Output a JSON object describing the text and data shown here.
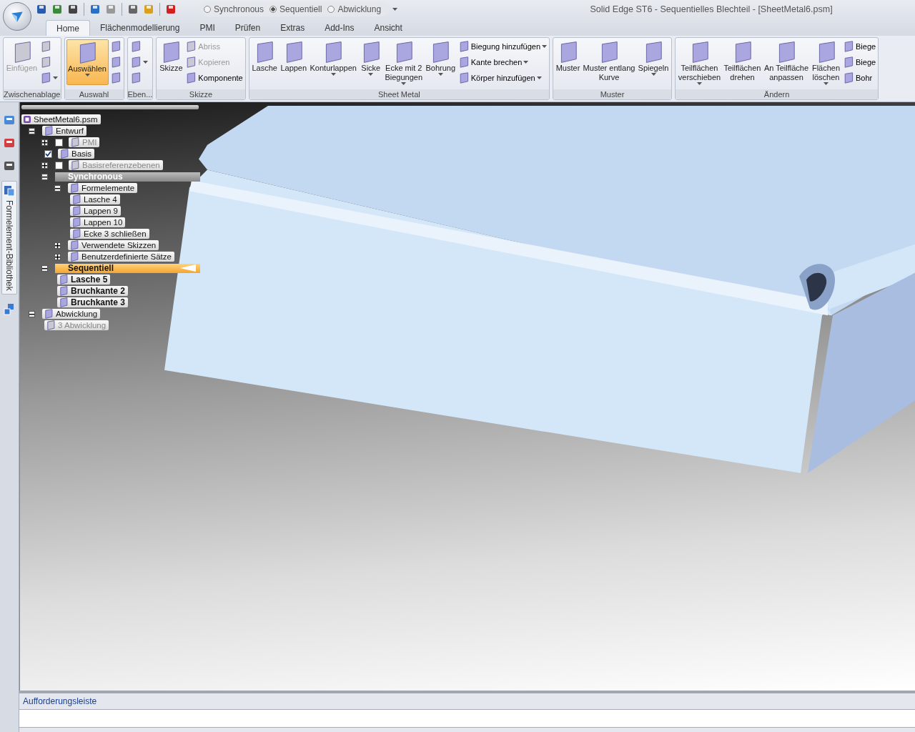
{
  "window": {
    "title": "Solid Edge ST6 - Sequentielles Blechteil - [SheetMetal6.psm]"
  },
  "modes": [
    {
      "label": "Synchronous",
      "selected": false
    },
    {
      "label": "Sequentiell",
      "selected": true
    },
    {
      "label": "Abwicklung",
      "selected": false
    }
  ],
  "tabs": [
    {
      "label": "Home",
      "selected": true
    },
    {
      "label": "Flächenmodellierung",
      "selected": false
    },
    {
      "label": "PMI",
      "selected": false
    },
    {
      "label": "Prüfen",
      "selected": false
    },
    {
      "label": "Extras",
      "selected": false
    },
    {
      "label": "Add-Ins",
      "selected": false
    },
    {
      "label": "Ansicht",
      "selected": false
    }
  ],
  "ribbon": [
    {
      "title": "Zwischenablage",
      "items": [
        {
          "kind": "large",
          "label": "Einfügen",
          "disabled": true,
          "selected": false,
          "dropdown": false
        },
        {
          "kind": "icon",
          "disabled": true,
          "dropdown": false
        },
        {
          "kind": "icon",
          "disabled": true,
          "dropdown": false
        },
        {
          "kind": "icon",
          "disabled": false,
          "dropdown": true
        }
      ]
    },
    {
      "title": "Auswahl",
      "items": [
        {
          "kind": "large",
          "label": "Auswählen",
          "disabled": false,
          "selected": true,
          "dropdown": true
        },
        {
          "kind": "icon",
          "disabled": false,
          "dropdown": false
        },
        {
          "kind": "icon",
          "disabled": false,
          "dropdown": false
        },
        {
          "kind": "icon",
          "disabled": false,
          "dropdown": false
        }
      ]
    },
    {
      "title": "Eben...",
      "items": [
        {
          "kind": "icon",
          "disabled": false,
          "dropdown": false
        },
        {
          "kind": "icon",
          "disabled": false,
          "dropdown": true
        },
        {
          "kind": "icon",
          "disabled": false,
          "dropdown": false
        }
      ]
    },
    {
      "title": "Skizze",
      "items": [
        {
          "kind": "large",
          "label": "Skizze",
          "disabled": false,
          "selected": false,
          "dropdown": false
        },
        {
          "kind": "small",
          "label": "Abriss",
          "disabled": true,
          "dropdown": false
        },
        {
          "kind": "small",
          "label": "Kopieren",
          "disabled": true,
          "dropdown": false
        },
        {
          "kind": "small",
          "label": "Komponente",
          "disabled": false,
          "dropdown": false
        }
      ]
    },
    {
      "title": "Sheet Metal",
      "items": [
        {
          "kind": "large",
          "label": "Lasche",
          "disabled": false,
          "selected": false,
          "dropdown": false
        },
        {
          "kind": "large",
          "label": "Lappen",
          "disabled": false,
          "selected": false,
          "dropdown": false
        },
        {
          "kind": "large",
          "label": "Konturlappen",
          "disabled": false,
          "selected": false,
          "dropdown": true
        },
        {
          "kind": "large",
          "label": "Sicke",
          "disabled": false,
          "selected": false,
          "dropdown": true
        },
        {
          "kind": "large",
          "label": "Ecke mit 2 Biegungen",
          "disabled": false,
          "selected": false,
          "dropdown": true
        },
        {
          "kind": "large",
          "label": "Bohrung",
          "disabled": false,
          "selected": false,
          "dropdown": true
        },
        {
          "kind": "small",
          "label": "Biegung hinzufügen",
          "disabled": false,
          "dropdown": true
        },
        {
          "kind": "small",
          "label": "Kante brechen",
          "disabled": false,
          "dropdown": true
        },
        {
          "kind": "small",
          "label": "Körper hinzufügen",
          "disabled": false,
          "dropdown": true
        }
      ]
    },
    {
      "title": "Muster",
      "items": [
        {
          "kind": "large",
          "label": "Muster",
          "disabled": false,
          "selected": false,
          "dropdown": false
        },
        {
          "kind": "large",
          "label": "Muster entlang Kurve",
          "disabled": false,
          "selected": false,
          "dropdown": false
        },
        {
          "kind": "large",
          "label": "Spiegeln",
          "disabled": false,
          "selected": false,
          "dropdown": true
        }
      ]
    },
    {
      "title": "Ändern",
      "items": [
        {
          "kind": "large",
          "label": "Teilflächen verschieben",
          "disabled": false,
          "selected": false,
          "dropdown": true
        },
        {
          "kind": "large",
          "label": "Teilflächen drehen",
          "disabled": false,
          "selected": false,
          "dropdown": false
        },
        {
          "kind": "large",
          "label": "An Teilfläche anpassen",
          "disabled": false,
          "selected": false,
          "dropdown": false
        },
        {
          "kind": "large",
          "label": "Flächen löschen",
          "disabled": false,
          "selected": false,
          "dropdown": true
        },
        {
          "kind": "small",
          "label": "Biege",
          "disabled": false,
          "dropdown": false
        },
        {
          "kind": "small",
          "label": "Biege",
          "disabled": false,
          "dropdown": false
        },
        {
          "kind": "small",
          "label": "Bohr",
          "disabled": false,
          "dropdown": false
        }
      ]
    }
  ],
  "side_tab": {
    "label": "Formelement-Bibliothek"
  },
  "tree": {
    "label": "SheetMetal6.psm",
    "kind": "file",
    "children": [
      {
        "label": "Entwurf",
        "kind": "node",
        "expanded": true,
        "children": [
          {
            "label": "PMI",
            "kind": "node",
            "expanded": false,
            "checked": false,
            "disabled": true
          },
          {
            "label": "Basis",
            "kind": "node",
            "checked": true
          },
          {
            "label": "Basisreferenzebenen",
            "kind": "node",
            "expanded": false,
            "checked": false,
            "disabled": true
          },
          {
            "label": "Synchronous",
            "kind": "section",
            "expanded": true,
            "selected": false,
            "children": [
              {
                "label": "Formelemente",
                "kind": "node",
                "expanded": true,
                "children": [
                  {
                    "label": "Lasche 4",
                    "kind": "node"
                  },
                  {
                    "label": "Lappen 9",
                    "kind": "node"
                  },
                  {
                    "label": "Lappen 10",
                    "kind": "node"
                  },
                  {
                    "label": "Ecke 3 schließen",
                    "kind": "node"
                  }
                ]
              },
              {
                "label": "Verwendete Skizzen",
                "kind": "node",
                "expanded": false
              },
              {
                "label": "Benutzerdefinierte Sätze",
                "kind": "node",
                "expanded": false
              }
            ]
          },
          {
            "label": "Sequentiell",
            "kind": "section",
            "expanded": true,
            "selected": true,
            "children": [
              {
                "label": "Lasche 5",
                "kind": "node",
                "bold": true
              },
              {
                "label": "Bruchkante 2",
                "kind": "node",
                "bold": true
              },
              {
                "label": "Bruchkante 3",
                "kind": "node",
                "bold": true
              }
            ]
          }
        ]
      },
      {
        "label": "Abwicklung",
        "kind": "node",
        "expanded": true,
        "children": [
          {
            "label": "3 Abwicklung",
            "kind": "node",
            "disabled": true
          }
        ]
      }
    ]
  },
  "prompt_bar": {
    "title": "Aufforderungsleiste"
  }
}
